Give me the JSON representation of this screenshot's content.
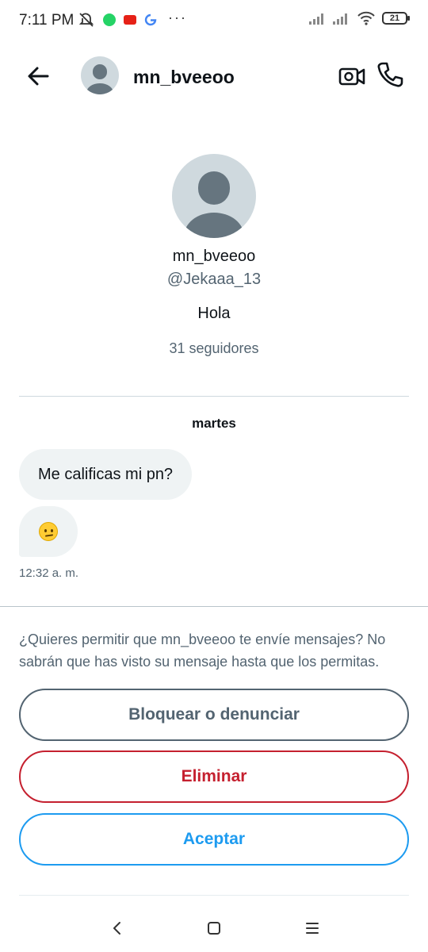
{
  "status_bar": {
    "time": "7:11 PM",
    "battery": "21",
    "overflow": "···"
  },
  "header": {
    "username": "mn_bveeoo",
    "icons": [
      "back-arrow-icon",
      "video-call-icon",
      "phone-call-icon"
    ]
  },
  "profile": {
    "name": "mn_bveeoo",
    "handle": "@Jekaaa_13",
    "bio": "Hola",
    "followers": "31 seguidores"
  },
  "conversation": {
    "day": "martes",
    "messages": [
      {
        "text": "Me calificas mi pn?"
      },
      {
        "emoji": "🫡"
      }
    ],
    "time": "12:32 a. m."
  },
  "request": {
    "prompt": "¿Quieres permitir que mn_bveeoo te envíe mensajes? No sabrán que has visto su mensaje hasta que los permitas.",
    "block_label": "Bloquear o denunciar",
    "delete_label": "Eliminar",
    "accept_label": "Aceptar"
  },
  "colors": {
    "accept": "#1d9bf0",
    "delete": "#c5202f",
    "secondary_text": "#536471",
    "bubble": "#eff3f4"
  }
}
